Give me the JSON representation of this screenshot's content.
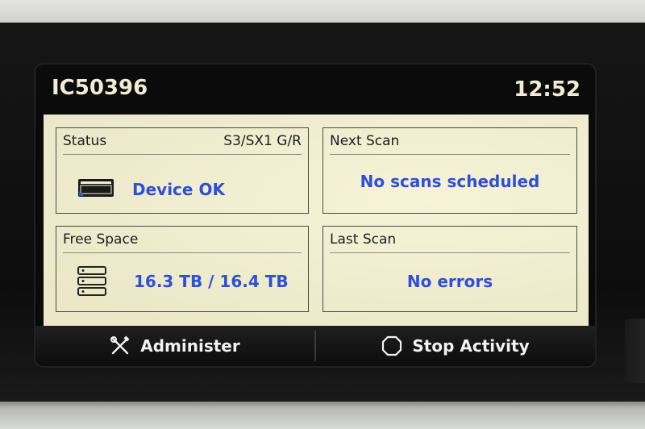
{
  "header": {
    "device_id": "IC50396",
    "time": "12:52"
  },
  "tiles": {
    "status": {
      "title": "Status",
      "code": "S3/SX1 G/R",
      "value": "Device OK",
      "icon": "device-icon"
    },
    "next_scan": {
      "title": "Next Scan",
      "value": "No scans scheduled"
    },
    "free_space": {
      "title": "Free Space",
      "value": "16.3 TB / 16.4 TB",
      "icon": "storage-icon"
    },
    "last_scan": {
      "title": "Last Scan",
      "value": "No errors"
    }
  },
  "footer": {
    "administer_label": "Administer",
    "administer_icon": "tools-icon",
    "stop_label": "Stop Activity",
    "stop_icon": "octagon-stop-icon"
  },
  "colors": {
    "accent_value": "#2e4fd8",
    "panel_bg": "#f2efd2",
    "header_text": "#f1ecd4"
  }
}
